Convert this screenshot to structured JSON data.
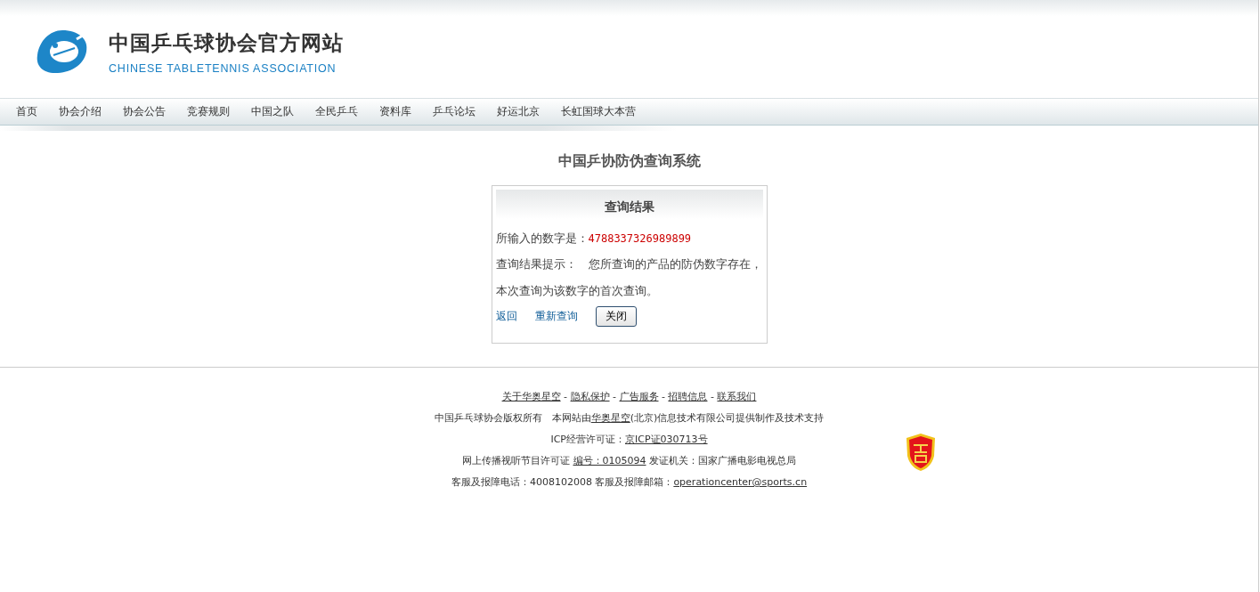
{
  "site": {
    "title": "中国乒乓球协会官方网站",
    "subtitle": "CHINESE TABLETENNIS ASSOCIATION"
  },
  "nav": {
    "items": [
      {
        "label": "首页"
      },
      {
        "label": "协会介绍"
      },
      {
        "label": "协会公告"
      },
      {
        "label": "竞赛规则"
      },
      {
        "label": "中国之队"
      },
      {
        "label": "全民乒乓"
      },
      {
        "label": "资料库"
      },
      {
        "label": "乒乓论坛"
      },
      {
        "label": "好运北京"
      },
      {
        "label": "长虹国球大本营"
      }
    ]
  },
  "page_title": "中国乒协防伪查询系统",
  "result": {
    "heading": "查询结果",
    "number_label": "所输入的数字是：",
    "number": "4788337326989899",
    "hint": "查询结果提示：　您所查询的产品的防伪数字存在，本次查询为该数字的首次查询。",
    "links": [
      "返回",
      "重新查询"
    ],
    "close_button": "关闭"
  },
  "footer": {
    "lines": [
      [
        {
          "text": "关于华奥星空",
          "link": true
        },
        {
          "text": " - ",
          "link": false
        },
        {
          "text": "隐私保护",
          "link": true
        },
        {
          "text": " - ",
          "link": false
        },
        {
          "text": "广告服务",
          "link": true
        },
        {
          "text": " - ",
          "link": false
        },
        {
          "text": "招聘信息",
          "link": true
        },
        {
          "text": " - ",
          "link": false
        },
        {
          "text": "联系我们",
          "link": true
        }
      ],
      [
        {
          "text": "中国乒乓球协会版权所有　本网站由",
          "link": false
        },
        {
          "text": "华奥星空",
          "link": true
        },
        {
          "text": "(北京)信息技术有限公司提供制作及技术支持",
          "link": false
        }
      ],
      [
        {
          "text": "ICP经营许可证：",
          "link": false
        },
        {
          "text": "京ICP证030713号",
          "link": true
        }
      ],
      [
        {
          "text": "网上传播视听节目许可证 ",
          "link": false
        },
        {
          "text": "编号：0105094",
          "link": true
        },
        {
          "text": " 发证机关：国家广播电影电视总局",
          "link": false
        }
      ],
      [
        {
          "text": "客服及报障电话：4008102008 客服及报障邮箱：",
          "link": false
        },
        {
          "text": "operationcenter@sports.cn",
          "link": true
        }
      ]
    ]
  }
}
